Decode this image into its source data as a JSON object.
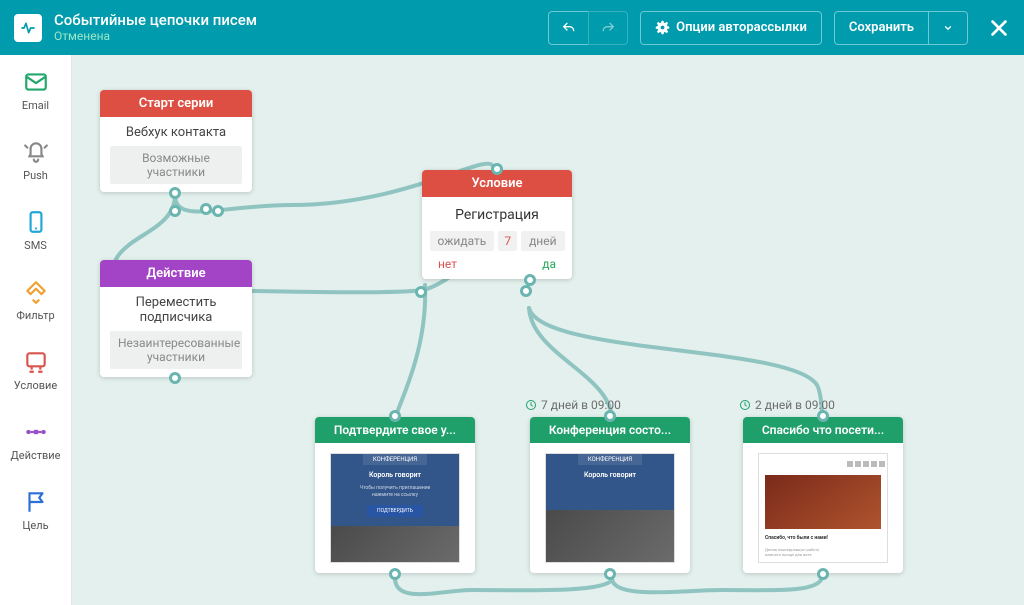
{
  "header": {
    "title": "Событийные цепочки писем",
    "status": "Отменена",
    "options": "Опции авторассылки",
    "save": "Сохранить"
  },
  "sidebar": {
    "email": "Email",
    "push": "Push",
    "sms": "SMS",
    "filter": "Фильтр",
    "condition": "Условие",
    "action": "Действие",
    "goal": "Цель"
  },
  "nodes": {
    "start": {
      "title": "Старт серии",
      "line1": "Вебхук контакта",
      "tag": "Возможные участники"
    },
    "action": {
      "title": "Действие",
      "line1": "Переместить подписчика",
      "tag": "Незаинтересованные участники"
    },
    "condition": {
      "title": "Условие",
      "subtitle": "Регистрация",
      "wait": "ожидать",
      "days_num": "7",
      "days_word": "дней",
      "no": "нет",
      "yes": "да"
    },
    "email1": {
      "title": "Подтвердите свое у..."
    },
    "email2": {
      "title": "Конференция состо..."
    },
    "email3": {
      "title": "Спасибо что посети..."
    }
  },
  "timers": {
    "t1": "7 дней в 09:00",
    "t2": "2 дней в 09:00"
  }
}
